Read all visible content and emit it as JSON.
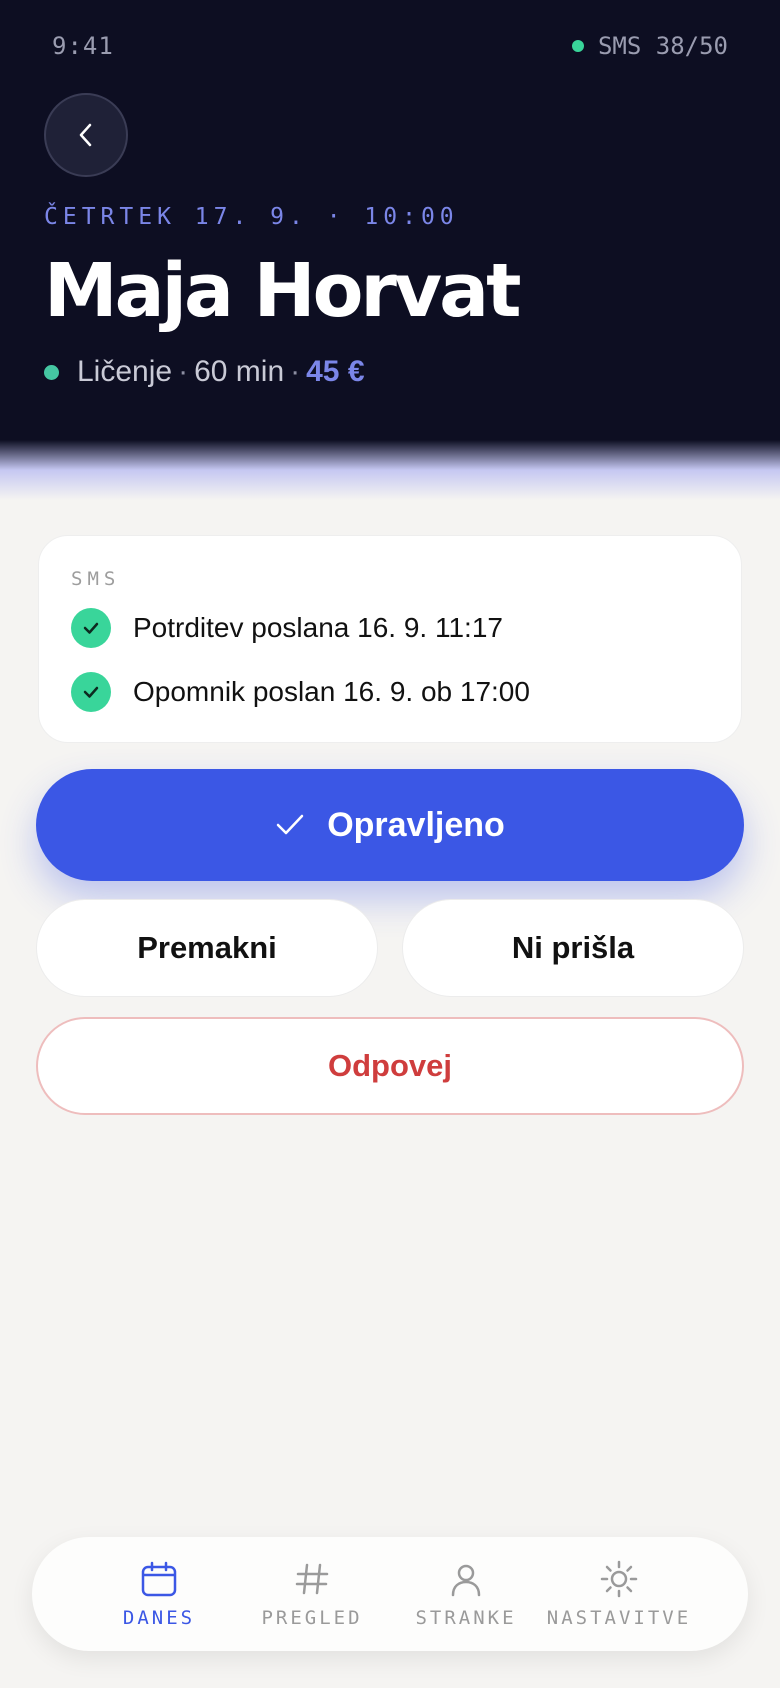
{
  "status_bar": {
    "time": "9:41",
    "sms_counter": "SMS 38/50"
  },
  "appointment": {
    "date_time": "ČETRTEK 17. 9. · 10:00",
    "client_name": "Maja Horvat",
    "service": "Ličenje",
    "duration": "60 min",
    "price": "45 €",
    "separator": "·"
  },
  "sms": {
    "title": "SMS",
    "items": [
      {
        "text": "Potrditev poslana 16. 9. 11:17",
        "status": "sent"
      },
      {
        "text": "Opomnik poslan 16. 9. ob 17:00",
        "status": "sent"
      }
    ]
  },
  "actions": {
    "done_label": "Opravljeno",
    "reschedule_label": "Premakni",
    "no_show_label": "Ni prišla",
    "cancel_label": "Odpovej"
  },
  "tab_bar": {
    "active": "danes",
    "items": [
      {
        "id": "danes",
        "label": "DANES",
        "icon": "calendar-icon"
      },
      {
        "id": "pregled",
        "label": "PREGLED",
        "icon": "hash-icon"
      },
      {
        "id": "stranke",
        "label": "STRANKE",
        "icon": "person-icon"
      },
      {
        "id": "nastavitve",
        "label": "NASTAVITVE",
        "icon": "sun-gear-icon"
      }
    ]
  },
  "colors": {
    "header_bg": "#0d0e22",
    "accent": "#3b57e5",
    "success": "#39d59a",
    "danger": "#cf3d3d",
    "price": "#7b86e8"
  }
}
